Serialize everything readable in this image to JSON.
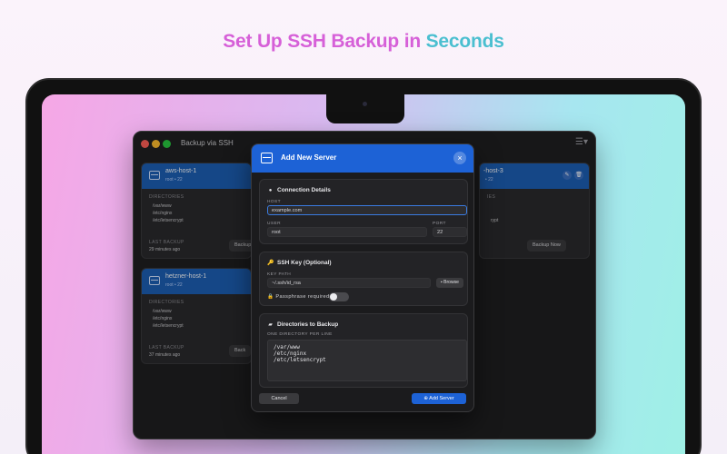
{
  "headline": {
    "part1": "Set Up SSH Backup in",
    "part2": "Seconds"
  },
  "window": {
    "title": "Backup via SSH",
    "menu_icon": "list-chevron-icon"
  },
  "cards": [
    {
      "name": "aws-host-1",
      "meta": "root • 22",
      "directories_label": "DIRECTORIES",
      "directories": [
        "/var/www",
        "/etc/nginx",
        "/etc/letsencrypt"
      ],
      "last_backup_label": "LAST BACKUP",
      "last_backup": "29 minutes ago",
      "button": "Backup"
    },
    {
      "name": "hetzner-host-1",
      "meta": "root • 22",
      "directories_label": "DIRECTORIES",
      "directories": [
        "/var/www",
        "/etc/nginx",
        "/etc/letsencrypt"
      ],
      "last_backup_label": "LAST BACKUP",
      "last_backup": "37 minutes ago",
      "button": "Back"
    },
    {
      "name": "-host-3",
      "meta": "• 22",
      "directories_label": "IES",
      "directories": [
        "",
        "",
        "rypt"
      ],
      "last_backup_label": "",
      "last_backup": "",
      "button": "Backup Now"
    }
  ],
  "modal": {
    "title": "Add New Server",
    "connection": {
      "title": "Connection Details",
      "host_label": "HOST",
      "host_value": "example.com",
      "user_label": "USER",
      "user_value": "root",
      "port_label": "PORT",
      "port_value": "22"
    },
    "ssh": {
      "title": "SSH Key (Optional)",
      "keypath_label": "KEY PATH",
      "keypath_value": "~/.ssh/id_rsa",
      "browse_label": "Browse",
      "passphrase_label": "Passphrase required"
    },
    "dirs": {
      "title": "Directories to Backup",
      "label": "ONE DIRECTORY PER LINE",
      "value": "/var/www\n/etc/nginx\n/etc/letsencrypt"
    },
    "cancel_label": "Cancel",
    "add_label": "Add Server"
  },
  "colors": {
    "accent": "#1d62d6",
    "card_header": "#1d5fb5"
  }
}
